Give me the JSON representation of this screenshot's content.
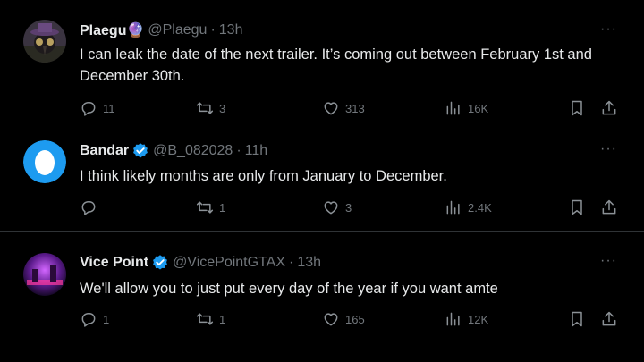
{
  "tweets": [
    {
      "name": "Plaegu🔮",
      "handle": "@Plaegu",
      "sep": "·",
      "time": "13h",
      "verified": false,
      "text": "I can leak the date of the next trailer. It’s coming out between February 1st and December 30th.",
      "replies": "11",
      "retweets": "3",
      "likes": "313",
      "views": "16K",
      "avatar": "plaegu-avatar"
    },
    {
      "name": "Bandar",
      "handle": "@B_082028",
      "sep": "·",
      "time": "11h",
      "verified": true,
      "text": "I think likely months are only from January to December.",
      "replies": "",
      "retweets": "1",
      "likes": "3",
      "views": "2.4K",
      "avatar": "default-egg-avatar"
    },
    {
      "name": "Vice Point",
      "handle": "@VicePointGTAX",
      "sep": "·",
      "time": "13h",
      "verified": true,
      "text": "We'll allow you to just put every day of the year if you want amte",
      "replies": "1",
      "retweets": "1",
      "likes": "165",
      "views": "12K",
      "avatar": "vice-point-avatar"
    }
  ],
  "more_glyph": "···",
  "colors": {
    "background": "#000000",
    "text": "#e7e9ea",
    "muted": "#71767b",
    "verified": "#1d9bf0",
    "divider": "#2f3336"
  }
}
